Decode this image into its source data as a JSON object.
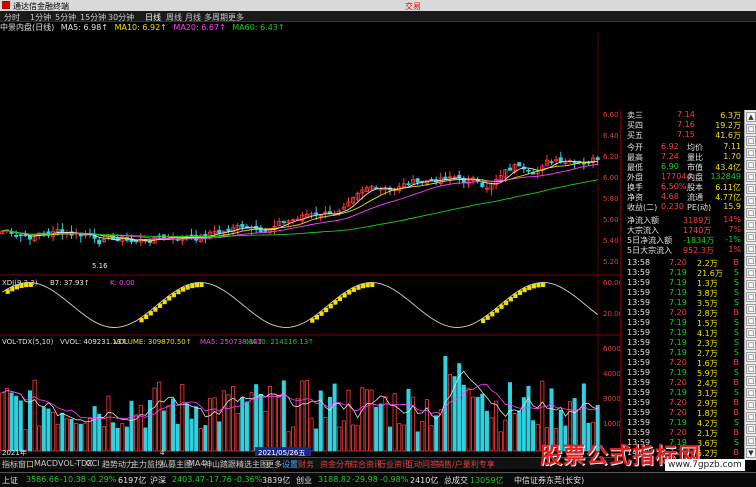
{
  "window": {
    "title": "通达信金融终端",
    "tag": "交易"
  },
  "menubar": {
    "items": [
      "分时",
      "1分钟",
      "5分钟",
      "15分钟",
      "30分钟",
      "日线",
      "周线",
      "月线",
      "多周期",
      "更多"
    ]
  },
  "chart_header": {
    "stock": "中景内盘(日线)",
    "indicators": [
      "MA5: 6.98↑",
      "MA10: 6.92↑",
      "MA20: 6.67↑",
      "MA60: 6.43↑"
    ],
    "indicator_colors": [
      "#e0e0e0",
      "#f0e000",
      "#ff40ff",
      "#18d018"
    ]
  },
  "price_axis": [
    "6.60",
    "6.40",
    "6.20",
    "6.00",
    "5.80",
    "5.60",
    "5.40",
    "5.20"
  ],
  "low_label": "5.16",
  "kdj": {
    "title": "XDJ(9,3,3)",
    "values": [
      "B7: 37.93↑",
      "K: 0.00"
    ],
    "axis": [
      "60.00",
      "20.00"
    ]
  },
  "vol": {
    "title": "VOL-TDX(5,10)",
    "values": [
      "VVOL: 409231.13↑",
      "VOLUME: 309870.50↑",
      "MA5: 250738.30↑",
      "MA10: 214116.13↑"
    ],
    "axis": [
      "60000",
      "40000",
      "30000",
      "10000"
    ]
  },
  "date_axis": [
    "2021年",
    "4",
    "2021/05/26五"
  ],
  "panel": {
    "asks": [
      {
        "label": "卖三",
        "price": "7.14",
        "vol": "6.3万"
      },
      {
        "label": "买四",
        "price": "7.16",
        "vol": "19.2万"
      },
      {
        "label": "买五",
        "price": "7.15",
        "vol": "41.6万"
      }
    ],
    "stats": [
      {
        "l1": "今开",
        "v1": "6.92",
        "l2": "均价",
        "v2": "7.11"
      },
      {
        "l1": "最高",
        "v1": "7.24",
        "l2": "量比",
        "v2": "1.70"
      },
      {
        "l1": "最低",
        "v1": "6.90",
        "l2": "市值",
        "v2": "43.4亿"
      },
      {
        "l1": "外盘",
        "v1": "177044",
        "l2": "内盘",
        "v2": "132849"
      },
      {
        "l1": "换手",
        "v1": "6.50%",
        "l2": "股本",
        "v2": "6.11亿"
      },
      {
        "l1": "净资",
        "v1": "4.68",
        "l2": "流通",
        "v2": "4.77亿"
      },
      {
        "l1": "收益(二)",
        "v1": "0.230",
        "l2": "PE(动)",
        "v2": "15.9"
      }
    ],
    "turnover_extra": "309893",
    "flows": [
      {
        "label": "净流入额",
        "value": "3189万",
        "pct": "14%"
      },
      {
        "label": "大宗流入",
        "value": "1740万",
        "pct": "7%"
      },
      {
        "label": "5日净流入额",
        "value": "-1834万",
        "pct": "-1%"
      },
      {
        "label": "5日大宗流入",
        "value": "952.3万",
        "pct": "1%"
      }
    ],
    "ticks": [
      {
        "t": "13:58",
        "p": "7.20",
        "v": "2.2万",
        "s": "B"
      },
      {
        "t": "13:59",
        "p": "7.19",
        "v": "21.6万",
        "s": "S"
      },
      {
        "t": "13:59",
        "p": "7.19",
        "v": "1.3万",
        "s": "S"
      },
      {
        "t": "13:59",
        "p": "7.19",
        "v": "3.8万",
        "s": "S"
      },
      {
        "t": "13:59",
        "p": "7.19",
        "v": "3.5万",
        "s": "S"
      },
      {
        "t": "13:59",
        "p": "7.20",
        "v": "2.8万",
        "s": "B"
      },
      {
        "t": "13:59",
        "p": "7.19",
        "v": "1.5万",
        "s": "S"
      },
      {
        "t": "13:59",
        "p": "7.19",
        "v": "4.1万",
        "s": "S"
      },
      {
        "t": "13:59",
        "p": "7.19",
        "v": "2.3万",
        "s": "S"
      },
      {
        "t": "13:59",
        "p": "7.19",
        "v": "2.7万",
        "s": "S"
      },
      {
        "t": "13:59",
        "p": "7.20",
        "v": "1.6万",
        "s": "B"
      },
      {
        "t": "13:59",
        "p": "7.19",
        "v": "5.9万",
        "s": "S"
      },
      {
        "t": "13:59",
        "p": "7.20",
        "v": "2.4万",
        "s": "B"
      },
      {
        "t": "13:59",
        "p": "7.19",
        "v": "3.1万",
        "s": "S"
      },
      {
        "t": "13:59",
        "p": "7.20",
        "v": "2.9万",
        "s": "B"
      },
      {
        "t": "13:59",
        "p": "7.20",
        "v": "1.8万",
        "s": "B"
      },
      {
        "t": "13:59",
        "p": "7.19",
        "v": "4.2万",
        "s": "S"
      },
      {
        "t": "13:59",
        "p": "7.20",
        "v": "2.1万",
        "s": "B"
      },
      {
        "t": "13:59",
        "p": "7.19",
        "v": "3.6万",
        "s": "S"
      },
      {
        "t": "14:00",
        "p": "7.20",
        "v": "5.2万",
        "s": "B"
      }
    ]
  },
  "tabs": [
    "指标",
    "窗口",
    "MACD",
    "VOL-TDX",
    "CCI",
    "趋势动力",
    "主力监控",
    "私募主图",
    "MA4",
    "神山踏跟",
    "精选主图",
    "更多",
    "设置",
    "财务",
    "资金分布",
    "综合资讯",
    "行业资讯",
    "互动问答",
    "销售/户量利专享"
  ],
  "statusbar": [
    {
      "label": "上证",
      "value": "3586.66",
      "chg": "-10.38",
      "pct": "-0.29%",
      "amt": "6197亿"
    },
    {
      "label": "沪深",
      "value": "2403.47",
      "chg": "-17.76",
      "pct": "-0.36%",
      "amt": "3839亿"
    },
    {
      "label": "创业",
      "value": "3188.82",
      "chg": "-29.98",
      "pct": "-0.98%",
      "amt": "2410亿"
    },
    {
      "label": "总成交",
      "value": "13059亿"
    }
  ],
  "statusbar_tail": "中信证券东莞(长安)",
  "watermark": {
    "text": "股票公式指标网",
    "url": "www.7gpzb.com"
  },
  "colors": {
    "up": "#ff3c3c",
    "down": "#30d0e0",
    "bg": "#000000",
    "ma5": "#e0e0e0",
    "ma10": "#f0e000",
    "ma20": "#ff40ff",
    "ma60": "#18d018",
    "kdj": "#f0e000"
  }
}
